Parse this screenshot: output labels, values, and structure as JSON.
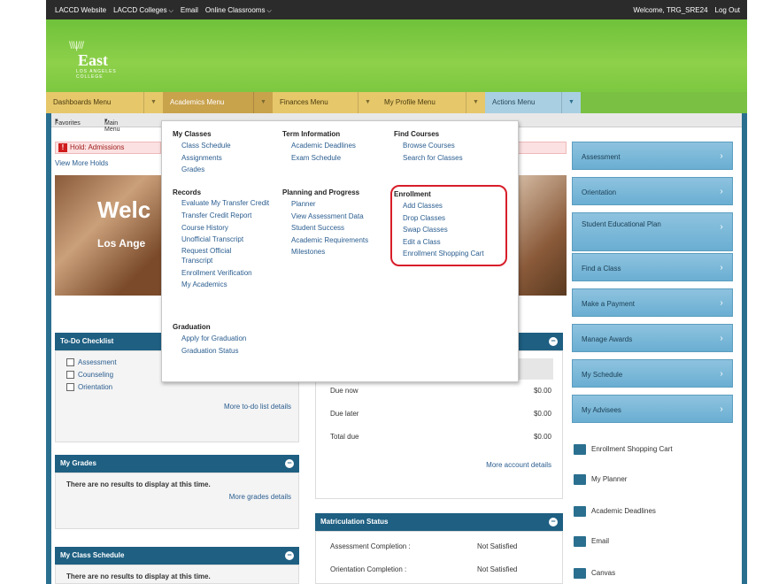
{
  "topbar": {
    "left": [
      "LACCD Website",
      "LACCD Colleges",
      "Email",
      "Online Classrooms"
    ],
    "welcome": "Welcome, TRG_SRE24",
    "logout": "Log Out"
  },
  "logo": {
    "text": "East",
    "sub": "LOS ANGELES COLLEGE"
  },
  "menu": {
    "dashboards": "Dashboards Menu",
    "academics": "Academics Menu",
    "finances": "Finances Menu",
    "profile": "My Profile Menu",
    "actions": "Actions Menu"
  },
  "subbar": {
    "favorites": "Favorites",
    "main_menu": "Main Menu"
  },
  "hold": {
    "badge": "!",
    "label": "Hold:",
    "value": "Admissions"
  },
  "view_holds": "View More Holds",
  "banner": {
    "welcome": "Welc",
    "sub": "Los Ange"
  },
  "dropdown": {
    "my_classes": {
      "title": "My Classes",
      "items": [
        "Class Schedule",
        "Assignments",
        "Grades"
      ]
    },
    "term_info": {
      "title": "Term Information",
      "items": [
        "Academic Deadlines",
        "Exam Schedule"
      ]
    },
    "find_courses": {
      "title": "Find Courses",
      "items": [
        "Browse Courses",
        "Search for Classes"
      ]
    },
    "records": {
      "title": "Records",
      "items": [
        "Evaluate My Transfer Credit",
        "Transfer Credit Report",
        "Course History",
        "Unofficial Transcript",
        "Request Official Transcript",
        "Enrollment Verification",
        "My Academics"
      ]
    },
    "planning": {
      "title": "Planning and Progress",
      "items": [
        "Planner",
        "View Assessment Data",
        "Student Success",
        "Academic Requirements",
        "Milestones"
      ]
    },
    "enrollment": {
      "title": "Enrollment",
      "items": [
        "Add Classes",
        "Drop Classes",
        "Swap Classes",
        "Edit a Class",
        "Enrollment Shopping Cart"
      ]
    },
    "graduation": {
      "title": "Graduation",
      "items": [
        "Apply for Graduation",
        "Graduation Status"
      ]
    }
  },
  "todo": {
    "title": "To-Do Checklist",
    "items": [
      "Assessment",
      "Counseling",
      "Orientation"
    ],
    "more": "More to-do list details"
  },
  "account": {
    "rows": [
      {
        "label": "Due now",
        "value": "$0.00"
      },
      {
        "label": "Due later",
        "value": "$0.00"
      },
      {
        "label": "Total due",
        "value": "$0.00"
      }
    ],
    "more": "More account details"
  },
  "grades": {
    "title": "My Grades",
    "empty": "There are no results to display at this time.",
    "more": "More grades details"
  },
  "class_schedule": {
    "title": "My Class Schedule",
    "empty": "There are no results to display at this time."
  },
  "matriculation": {
    "title": "Matriculation Status",
    "rows": [
      {
        "label": "Assessment Completion :",
        "value": "Not Satisfied"
      },
      {
        "label": "Orientation Completion :",
        "value": "Not Satisfied"
      }
    ]
  },
  "sidebar": [
    "Assessment",
    "Orientation",
    "Student Educational Plan",
    "Find a Class",
    "Make a Payment",
    "Manage Awards",
    "My Schedule",
    "My Advisees"
  ],
  "quick_links": [
    "Enrollment Shopping Cart",
    "My Planner",
    "Academic Deadlines",
    "Email",
    "Canvas"
  ]
}
